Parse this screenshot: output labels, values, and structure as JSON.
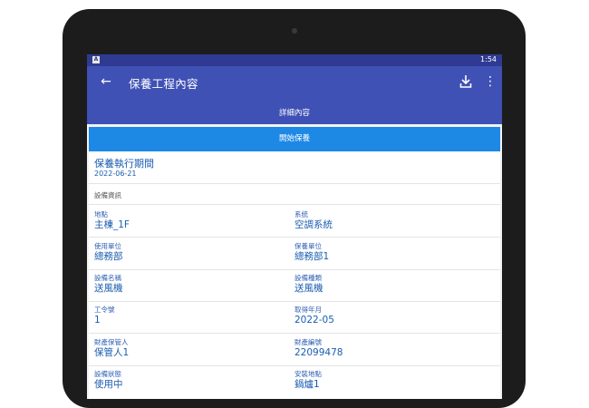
{
  "statusbar": {
    "notification_letter": "A",
    "time": "1:54"
  },
  "appbar": {
    "title": "保養工程內容",
    "back_icon": "arrow-left-icon",
    "download_icon": "download-icon",
    "more_icon": "more-vert-icon"
  },
  "tab": {
    "label": "詳細內容"
  },
  "start_button": {
    "label": "開始保養"
  },
  "period": {
    "label": "保養執行期間",
    "date": "2022-06-21"
  },
  "section": {
    "title": "設備資訊"
  },
  "rows": [
    {
      "left": {
        "label": "地點",
        "value": "主棟_1F"
      },
      "right": {
        "label": "系统",
        "value": "空調系統"
      }
    },
    {
      "left": {
        "label": "使用單位",
        "value": "總務部"
      },
      "right": {
        "label": "保養單位",
        "value": "總務部1"
      }
    },
    {
      "left": {
        "label": "設備名稱",
        "value": "送風機"
      },
      "right": {
        "label": "設備種類",
        "value": "送風機"
      }
    },
    {
      "left": {
        "label": "工令號",
        "value": "1"
      },
      "right": {
        "label": "取得年月",
        "value": "2022-05"
      }
    },
    {
      "left": {
        "label": "財產保管人",
        "value": "保管人1"
      },
      "right": {
        "label": "財產編號",
        "value": "22099478"
      }
    },
    {
      "left": {
        "label": "設備狀態",
        "value": "使用中"
      },
      "right": {
        "label": "安裝地點",
        "value": "鍋爐1"
      }
    }
  ],
  "colors": {
    "status_bar": "#2f3b92",
    "app_bar": "#3f51b5",
    "start_button": "#1e88e5",
    "text_blue": "#1a5cb0"
  }
}
